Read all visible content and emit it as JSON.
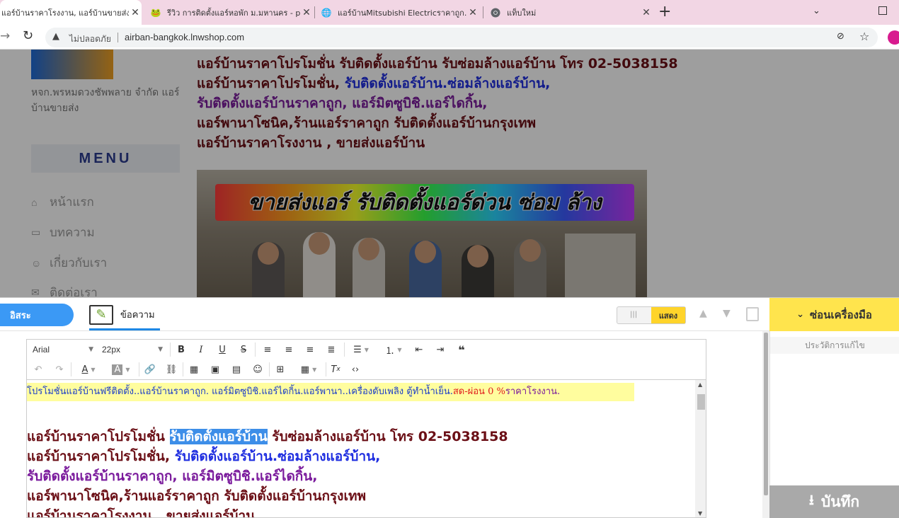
{
  "browser": {
    "tabs": [
      {
        "title": "แอร์บ้านราคาโรงงาน, แอร์บ้านขายส่ง, แ",
        "favicon": "page-icon"
      },
      {
        "title": "รีวิว การติดตั้งแอร์หอพัก ม.มหานคร - p",
        "favicon": "frog-icon"
      },
      {
        "title": "แอร์บ้านMitsubishi Electricราคาถูก.",
        "favicon": "globe-icon"
      },
      {
        "title": "แท็บใหม่",
        "favicon": "chrome-icon"
      }
    ],
    "new_tab": "+",
    "security_label": "ไม่ปลอดภัย",
    "url": "airban-bangkok.lnwshop.com"
  },
  "sidebar": {
    "company": "หจก.พรหมดวงชัพพลาย จำกัด แอร์บ้านขายส่ง",
    "menu_title": "MENU",
    "items": [
      {
        "label": "หน้าแรก",
        "icon": "home-icon"
      },
      {
        "label": "บทความ",
        "icon": "book-icon"
      },
      {
        "label": "เกี่ยวกับเรา",
        "icon": "smile-icon"
      },
      {
        "label": "ติดต่อเรา",
        "icon": "mail-icon"
      }
    ]
  },
  "content": {
    "lines": [
      {
        "text": "แอร์บ้านราคาโปรโมชั่น รับติดตั้งแอร์บ้าน รับซ่อมล้างแอร์บ้าน โทร 02-5038158",
        "color": "#6b0f16"
      },
      {
        "a": "แอร์บ้านราคาโปรโมชั่น,  ",
        "b": "รับติดตั้งแอร์บ้าน.ซ่อมล้างแอร์บ้าน,",
        "color_a": "#6b0f16",
        "color_b": "#1f2ee0"
      },
      {
        "text": "รับติดตั้งแอร์บ้านราคาถูก,  แอร์มิตซูบิชิ.แอร์ไดกิ้น,",
        "color": "#7a1a9c"
      },
      {
        "text": "แอร์พานาโซนิค,ร้านแอร์ราคาถูก รับติดตั้งแอร์บ้านกรุงเทพ",
        "color": "#6b0f16"
      },
      {
        "text": "แอร์บ้านราคาโรงงาน , ขายส่งแอร์บ้าน",
        "color": "#6b0f16"
      }
    ],
    "banner_text": "ขายส่งแอร์ รับติดตั้งแอร์ด่วน ซ่อม ล้าง"
  },
  "editor": {
    "free_label": "อิสระ",
    "tab_message": "ข้อความ",
    "toggle_show": "แสดง",
    "hide_tools": "ซ่อนเครื่องมือ",
    "history": "ประวัติการแก้ไข",
    "save": "บันทึก",
    "font_family": "Arial",
    "font_size": "22px",
    "promo_a": "โปรโมชั่นแอร์บ้านฟรีติดตั้ง..แอร์บ้านราคาถูก. แอร์มิตซูบิชิ.แอร์ไดกิ้น.แอร์พานา..เครื่องดับเพลิง ตู้ทำน้ำเย็น.",
    "promo_b": "สด-ผ่อน 0 %",
    "promo_c": "ราคาโรงงาน.",
    "body_line1_a": "แอร์บ้านราคาโปรโมชั่น ",
    "body_line1_sel": "รับติดตั้งแอร์บ้าน",
    "body_line1_b": " รับซ่อมล้างแอร์บ้าน โทร 02-5038158",
    "body_line2_a": "แอร์บ้านราคาโปรโมชั่น,  ",
    "body_line2_b": "รับติดตั้งแอร์บ้าน.ซ่อมล้างแอร์บ้าน,",
    "body_line3": "รับติดตั้งแอร์บ้านราคาถูก,  แอร์มิตซูบิชิ.แอร์ไดกิ้น,",
    "body_line4": "แอร์พานาโซนิค,ร้านแอร์ราคาถูก รับติดตั้งแอร์บ้านกรุงเทพ",
    "body_line5": "แอร์บ้านราคาโรงงาน , ขายส่งแอร์บ้าน"
  }
}
